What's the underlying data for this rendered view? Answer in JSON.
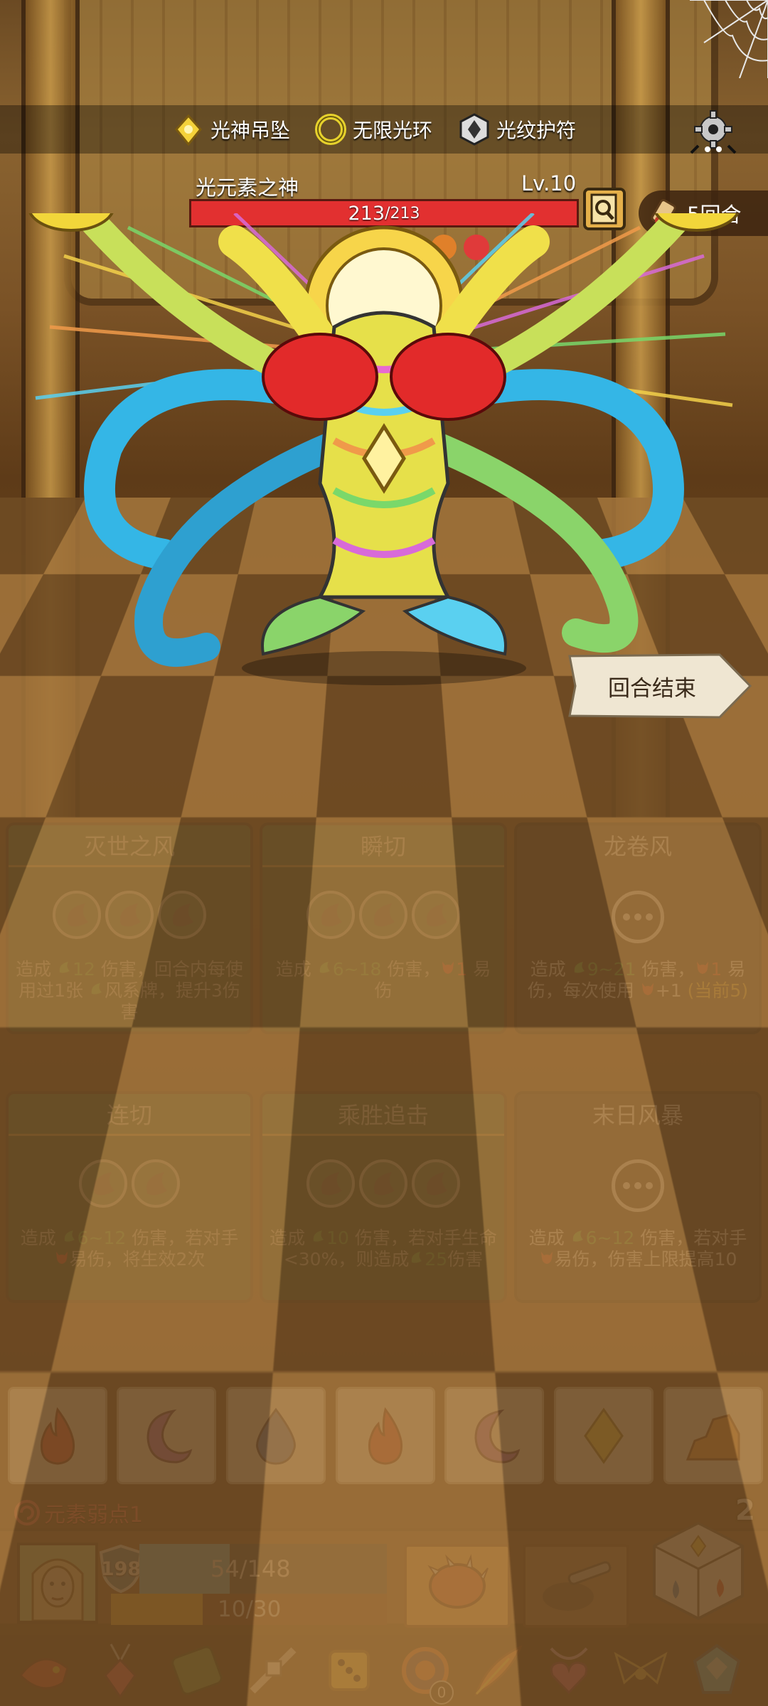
{
  "relics_top": [
    {
      "name": "光神吊坠",
      "icon": "light-pendant-icon"
    },
    {
      "name": "无限光环",
      "icon": "infinite-halo-icon"
    },
    {
      "name": "光纹护符",
      "icon": "light-amulet-icon"
    }
  ],
  "boss": {
    "name": "光元素之神",
    "level": "Lv.10",
    "hp_current": "213",
    "hp_max": "/213",
    "hp_fraction": 1.0
  },
  "turns": "5回合",
  "end_turn_label": "回合结束",
  "cards": [
    {
      "title": "灭世之风",
      "style": "green",
      "slots": 3,
      "desc": [
        {
          "t": "造成 "
        },
        {
          "t": "12",
          "c": "g",
          "icon": "wind"
        },
        {
          "t": " 伤害，回合内每使用过1张 "
        },
        {
          "t": "",
          "icon": "wind"
        },
        {
          "t": "风系牌，提升3伤害"
        }
      ]
    },
    {
      "title": "瞬切",
      "style": "green",
      "slots": 3,
      "desc": [
        {
          "t": "造成 "
        },
        {
          "t": "6~18",
          "c": "g",
          "icon": "wind"
        },
        {
          "t": " 伤害，"
        },
        {
          "t": "1",
          "c": "r",
          "icon": "devil"
        },
        {
          "t": " 易伤"
        }
      ]
    },
    {
      "title": "龙卷风",
      "style": "dark",
      "slots": 0,
      "desc": [
        {
          "t": "造成 "
        },
        {
          "t": "9~21",
          "c": "g",
          "icon": "wind"
        },
        {
          "t": " 伤害，"
        },
        {
          "t": "1",
          "c": "r",
          "icon": "devil"
        },
        {
          "t": " 易伤，每次使用 "
        },
        {
          "t": "+1",
          "c": "w",
          "icon": "devil"
        },
        {
          "t": " (当前5)",
          "c": "y"
        }
      ]
    },
    {
      "title": "连切",
      "style": "green",
      "slots": 2,
      "desc": [
        {
          "t": "造成 "
        },
        {
          "t": "6~12",
          "c": "g",
          "icon": "wind"
        },
        {
          "t": " 伤害，若对手 "
        },
        {
          "t": "",
          "icon": "devil"
        },
        {
          "t": "易伤，将生效2次"
        }
      ]
    },
    {
      "title": "乘胜追击",
      "style": "green",
      "slots": 3,
      "desc": [
        {
          "t": "造成 "
        },
        {
          "t": "10",
          "c": "g",
          "icon": "wind"
        },
        {
          "t": " 伤害，若对手生命<30%，则造成"
        },
        {
          "t": "25",
          "c": "g",
          "icon": "wind"
        },
        {
          "t": "伤害"
        }
      ]
    },
    {
      "title": "末日风暴",
      "style": "dark",
      "slots": 0,
      "desc": [
        {
          "t": "造成 "
        },
        {
          "t": "6~12",
          "c": "g",
          "icon": "wind"
        },
        {
          "t": " 伤害，若对手 "
        },
        {
          "t": "",
          "icon": "devil"
        },
        {
          "t": "易伤，伤害上限提高10"
        }
      ]
    }
  ],
  "dice": [
    "fire",
    "moon",
    "water",
    "fire",
    "moon",
    "light",
    "earth"
  ],
  "weakness_label": "元素弱点1",
  "reroll_count": "2",
  "player": {
    "shield": "198",
    "hp_text": "54/148",
    "hp_fraction": 0.365,
    "energy_text": "10/30",
    "energy_fraction": 0.333
  },
  "inventory": [
    {
      "icon": "red-fish-icon"
    },
    {
      "icon": "red-gem-pendant-icon"
    },
    {
      "icon": "green-scroll-icon"
    },
    {
      "icon": "dice-sword-icon"
    },
    {
      "icon": "golden-dice-icon"
    },
    {
      "icon": "fire-ring-icon",
      "count": "0"
    },
    {
      "icon": "phoenix-feather-icon"
    },
    {
      "icon": "heart-necklace-icon"
    },
    {
      "icon": "dark-wings-icon"
    },
    {
      "icon": "blue-crystal-icon"
    }
  ],
  "colors": {
    "hp_red": "#e23030",
    "card_green": "#1d4a30",
    "card_dark": "#262626",
    "wind_green": "#3fb84a",
    "fire_red": "#e23a2a"
  }
}
